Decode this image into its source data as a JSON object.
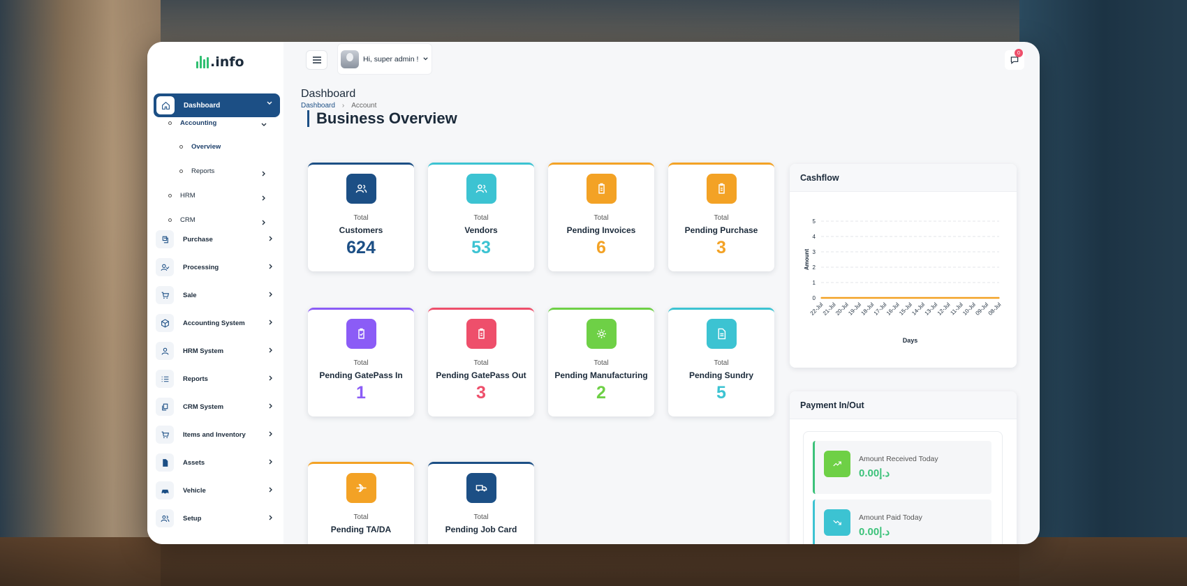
{
  "logo": {
    "text": ".info"
  },
  "header": {
    "greeting": "Hi, super admin !",
    "notification_count": "0"
  },
  "sidebar": {
    "dashboard": "Dashboard",
    "accounting": "Accounting",
    "overview": "Overview",
    "reports_sub": "Reports",
    "hrm": "HRM",
    "crm": "CRM",
    "items": [
      {
        "label": "Purchase",
        "icon": "purchase-icon"
      },
      {
        "label": "Processing",
        "icon": "processing-icon"
      },
      {
        "label": "Sale",
        "icon": "cart-icon"
      },
      {
        "label": "Accounting System",
        "icon": "cube-icon"
      },
      {
        "label": "HRM System",
        "icon": "user-icon"
      },
      {
        "label": "Reports",
        "icon": "list-icon"
      },
      {
        "label": "CRM System",
        "icon": "copy-icon"
      },
      {
        "label": "Items and Inventory",
        "icon": "cart-icon"
      },
      {
        "label": "Assets",
        "icon": "file-icon"
      },
      {
        "label": "Vehicle",
        "icon": "car-icon"
      },
      {
        "label": "Setup",
        "icon": "users-icon"
      }
    ]
  },
  "page": {
    "title": "Dashboard",
    "breadcrumb": [
      "Dashboard",
      "Account"
    ],
    "section_title": "Business Overview"
  },
  "cards": [
    {
      "total": "Total",
      "name": "Customers",
      "value": "624",
      "color": "#1c4f85",
      "icon": "users-icon"
    },
    {
      "total": "Total",
      "name": "Vendors",
      "value": "53",
      "color": "#3cc3d2",
      "icon": "users-icon"
    },
    {
      "total": "Total",
      "name": "Pending Invoices",
      "value": "6",
      "color": "#f3a225",
      "icon": "clipboard-icon"
    },
    {
      "total": "Total",
      "name": "Pending Purchase",
      "value": "3",
      "color": "#f3a225",
      "icon": "clipboard-icon"
    },
    {
      "total": "Total",
      "name": "Pending GatePass In",
      "value": "1",
      "color": "#8b5cf6",
      "icon": "clipboard-check-icon"
    },
    {
      "total": "Total",
      "name": "Pending GatePass Out",
      "value": "3",
      "color": "#ee4f6b",
      "icon": "clipboard-icon"
    },
    {
      "total": "Total",
      "name": "Pending Manufacturing",
      "value": "2",
      "color": "#6ed046",
      "icon": "gear-icon"
    },
    {
      "total": "Total",
      "name": "Pending Sundry",
      "value": "5",
      "color": "#3cc3d2",
      "icon": "document-icon"
    },
    {
      "total": "Total",
      "name": "Pending TA/DA",
      "value": "",
      "color": "#f3a225",
      "icon": "plane-icon"
    },
    {
      "total": "Total",
      "name": "Pending Job Card",
      "value": "",
      "color": "#1c4f85",
      "icon": "truck-icon"
    }
  ],
  "cashflow": {
    "title": "Cashflow"
  },
  "chart_data": {
    "type": "line",
    "xlabel": "Days",
    "ylabel": "Amount",
    "ylim": [
      0,
      5
    ],
    "yticks": [
      "0",
      "1",
      "2",
      "3",
      "4",
      "5"
    ],
    "categories": [
      "22-Jul",
      "21-Jul",
      "20-Jul",
      "19-Jul",
      "18-Jul",
      "17-Jul",
      "16-Jul",
      "15-Jul",
      "14-Jul",
      "13-Jul",
      "12-Jul",
      "11-Jul",
      "10-Jul",
      "09-Jul",
      "08-Jul"
    ],
    "series": [
      {
        "values": [
          0,
          0,
          0,
          0,
          0,
          0,
          0,
          0,
          0,
          0,
          0,
          0,
          0,
          0,
          0
        ],
        "color": "#f3a225"
      }
    ],
    "grid": true
  },
  "payment": {
    "title": "Payment In/Out",
    "received_label": "Amount Received Today",
    "received_value": "0.00د.إ",
    "paid_label": "Amount Paid Today",
    "paid_value": "0.00د.إ"
  }
}
